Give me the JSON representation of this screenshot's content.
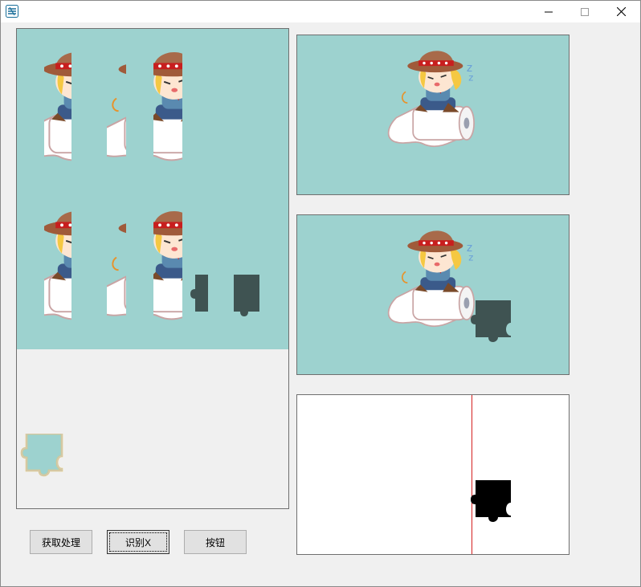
{
  "window": {
    "title": ""
  },
  "controls": {
    "minimize_icon": "minimize-icon",
    "maximize_icon": "maximize-icon",
    "close_icon": "close-icon"
  },
  "colors": {
    "canvas_bg": "#9dd2cf",
    "puzzle_dark": "#3f5352",
    "guide_line": "#d42020",
    "result_bg": "#ffffff"
  },
  "buttons": {
    "fetch_label": "获取处理",
    "recognize_label": "识别X",
    "generic_label": "按钮"
  }
}
